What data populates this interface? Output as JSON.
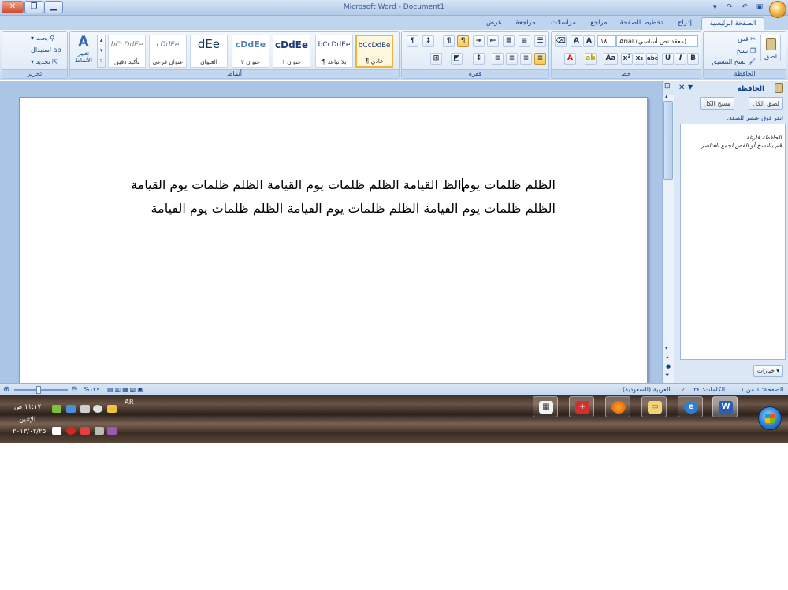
{
  "window": {
    "title": "Microsoft Word - Document1",
    "controls": {
      "close": "✕",
      "restore": "❐",
      "minimize": "▁"
    }
  },
  "ribbon": {
    "tabs": [
      {
        "label": "الصفحة الرئيسية",
        "active": true
      },
      {
        "label": "إدراج"
      },
      {
        "label": "تخطيط الصفحة"
      },
      {
        "label": "مراجع"
      },
      {
        "label": "مراسلات"
      },
      {
        "label": "مراجعة"
      },
      {
        "label": "عرض"
      }
    ],
    "clipboard": {
      "group_label": "الحافظة",
      "paste": "لصق",
      "cut": "قص",
      "copy": "نسخ",
      "format_painter": "نسخ التنسيق"
    },
    "font": {
      "group_label": "خط",
      "face": "Arial (معقد نص أساسي)",
      "size": "١٨"
    },
    "paragraph": {
      "group_label": "فقرة"
    },
    "styles": {
      "group_label": "أنماط",
      "change_styles": "تغيير الأنماط",
      "items": [
        {
          "sample": "bCcDdEe",
          "name": "¶ عادي",
          "selected": true
        },
        {
          "sample": "bCcDdEe",
          "name": "¶ بلا تباعد"
        },
        {
          "sample": "cDdEe",
          "name": "عنوان ١"
        },
        {
          "sample": "cDdEe",
          "name": "عنوان ٢"
        },
        {
          "sample": "dEe",
          "name": "العنوان"
        },
        {
          "sample": "cDdEe",
          "name": "عنوان فرعي"
        },
        {
          "sample": "bCcDdEe",
          "name": "تأكيد دقيق"
        }
      ]
    },
    "editing": {
      "group_label": "تحرير",
      "find": "بحث",
      "replace": "استبدال",
      "select": "تحديد"
    }
  },
  "document": {
    "text_before_caret": "الظلم ظلمات يوم",
    "text_after_caret": "الظ القيامة الظلم ظلمات يوم القيامة الظلم ظلمات يوم القيامة الظلم ظلمات يوم القيامة الظلم ظلمات يوم القيامة الظلم ظلمات يوم القيامة"
  },
  "clipboard_pane": {
    "title": "الحافظة",
    "paste_all": "لصق الكل",
    "clear_all": "مسح الكل",
    "hint": "انقر فوق عنصر للصقه:",
    "empty_line1": "الحافظة فارغة.",
    "empty_line2": "قم بالنسخ أو القص لجمع العناصر.",
    "options": "خيارات ▾"
  },
  "statusbar": {
    "page": "الصفحة: ١ من ١",
    "words": "الكلمات: ٣٤",
    "language": "العربية (السعودية)",
    "zoom": "%١٢٧"
  },
  "taskbar": {
    "time": "١١:١٧ ص",
    "day": "الإثنين",
    "date": "٢٠١٣/٠٢/٢٥",
    "language": "AR"
  },
  "colors": {
    "ribbon_accent": "#15428b",
    "selected_style": "#f2b23e",
    "taskbar": "#4a382d"
  }
}
